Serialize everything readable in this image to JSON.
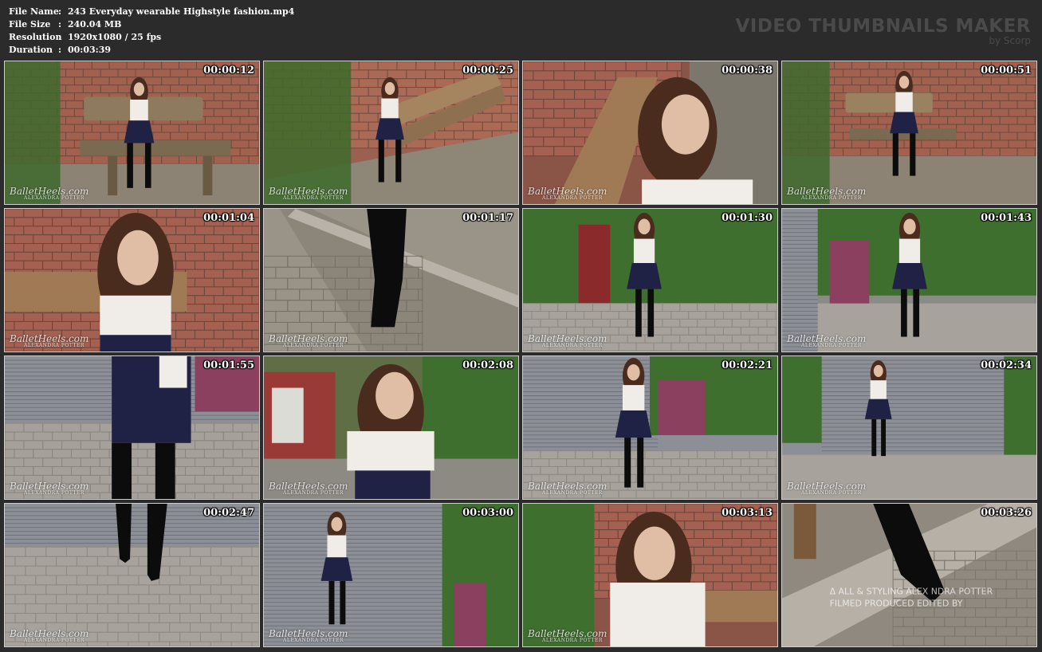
{
  "info": {
    "rows": [
      {
        "label": "File Name",
        "value": "243 Everyday wearable Highstyle fashion.mp4"
      },
      {
        "label": "File Size",
        "value": "240.04 MB"
      },
      {
        "label": "Resolution",
        "value": "1920x1080 / 25 fps"
      },
      {
        "label": "Duration",
        "value": "00:03:39"
      }
    ]
  },
  "brand": {
    "title": "VIDEO THUMBNAILS MAKER",
    "subtitle": "by Scorp"
  },
  "watermark": {
    "text": "BalletHeels.com",
    "sub": "ALEXANDRA POTTER"
  },
  "thumbnails": [
    {
      "time": "00:00:12",
      "scene": "bench-wall"
    },
    {
      "time": "00:00:25",
      "scene": "bench-ivy"
    },
    {
      "time": "00:00:38",
      "scene": "closeup-bench"
    },
    {
      "time": "00:00:51",
      "scene": "bench-wall-far"
    },
    {
      "time": "00:01:04",
      "scene": "closeup-wall"
    },
    {
      "time": "00:01:17",
      "scene": "boot-curb"
    },
    {
      "time": "00:01:30",
      "scene": "ivy-court"
    },
    {
      "time": "00:01:43",
      "scene": "ivy-shutter"
    },
    {
      "time": "00:01:55",
      "scene": "shutter-close"
    },
    {
      "time": "00:02:08",
      "scene": "street-portrait"
    },
    {
      "time": "00:02:21",
      "scene": "shutter-standing"
    },
    {
      "time": "00:02:34",
      "scene": "shutter-back"
    },
    {
      "time": "00:02:47",
      "scene": "shutter-legs"
    },
    {
      "time": "00:03:00",
      "scene": "shutter-ivy"
    },
    {
      "time": "00:03:13",
      "scene": "closeup-ivy-wall"
    },
    {
      "time": "00:03:26",
      "scene": "boot-curb-end"
    }
  ]
}
